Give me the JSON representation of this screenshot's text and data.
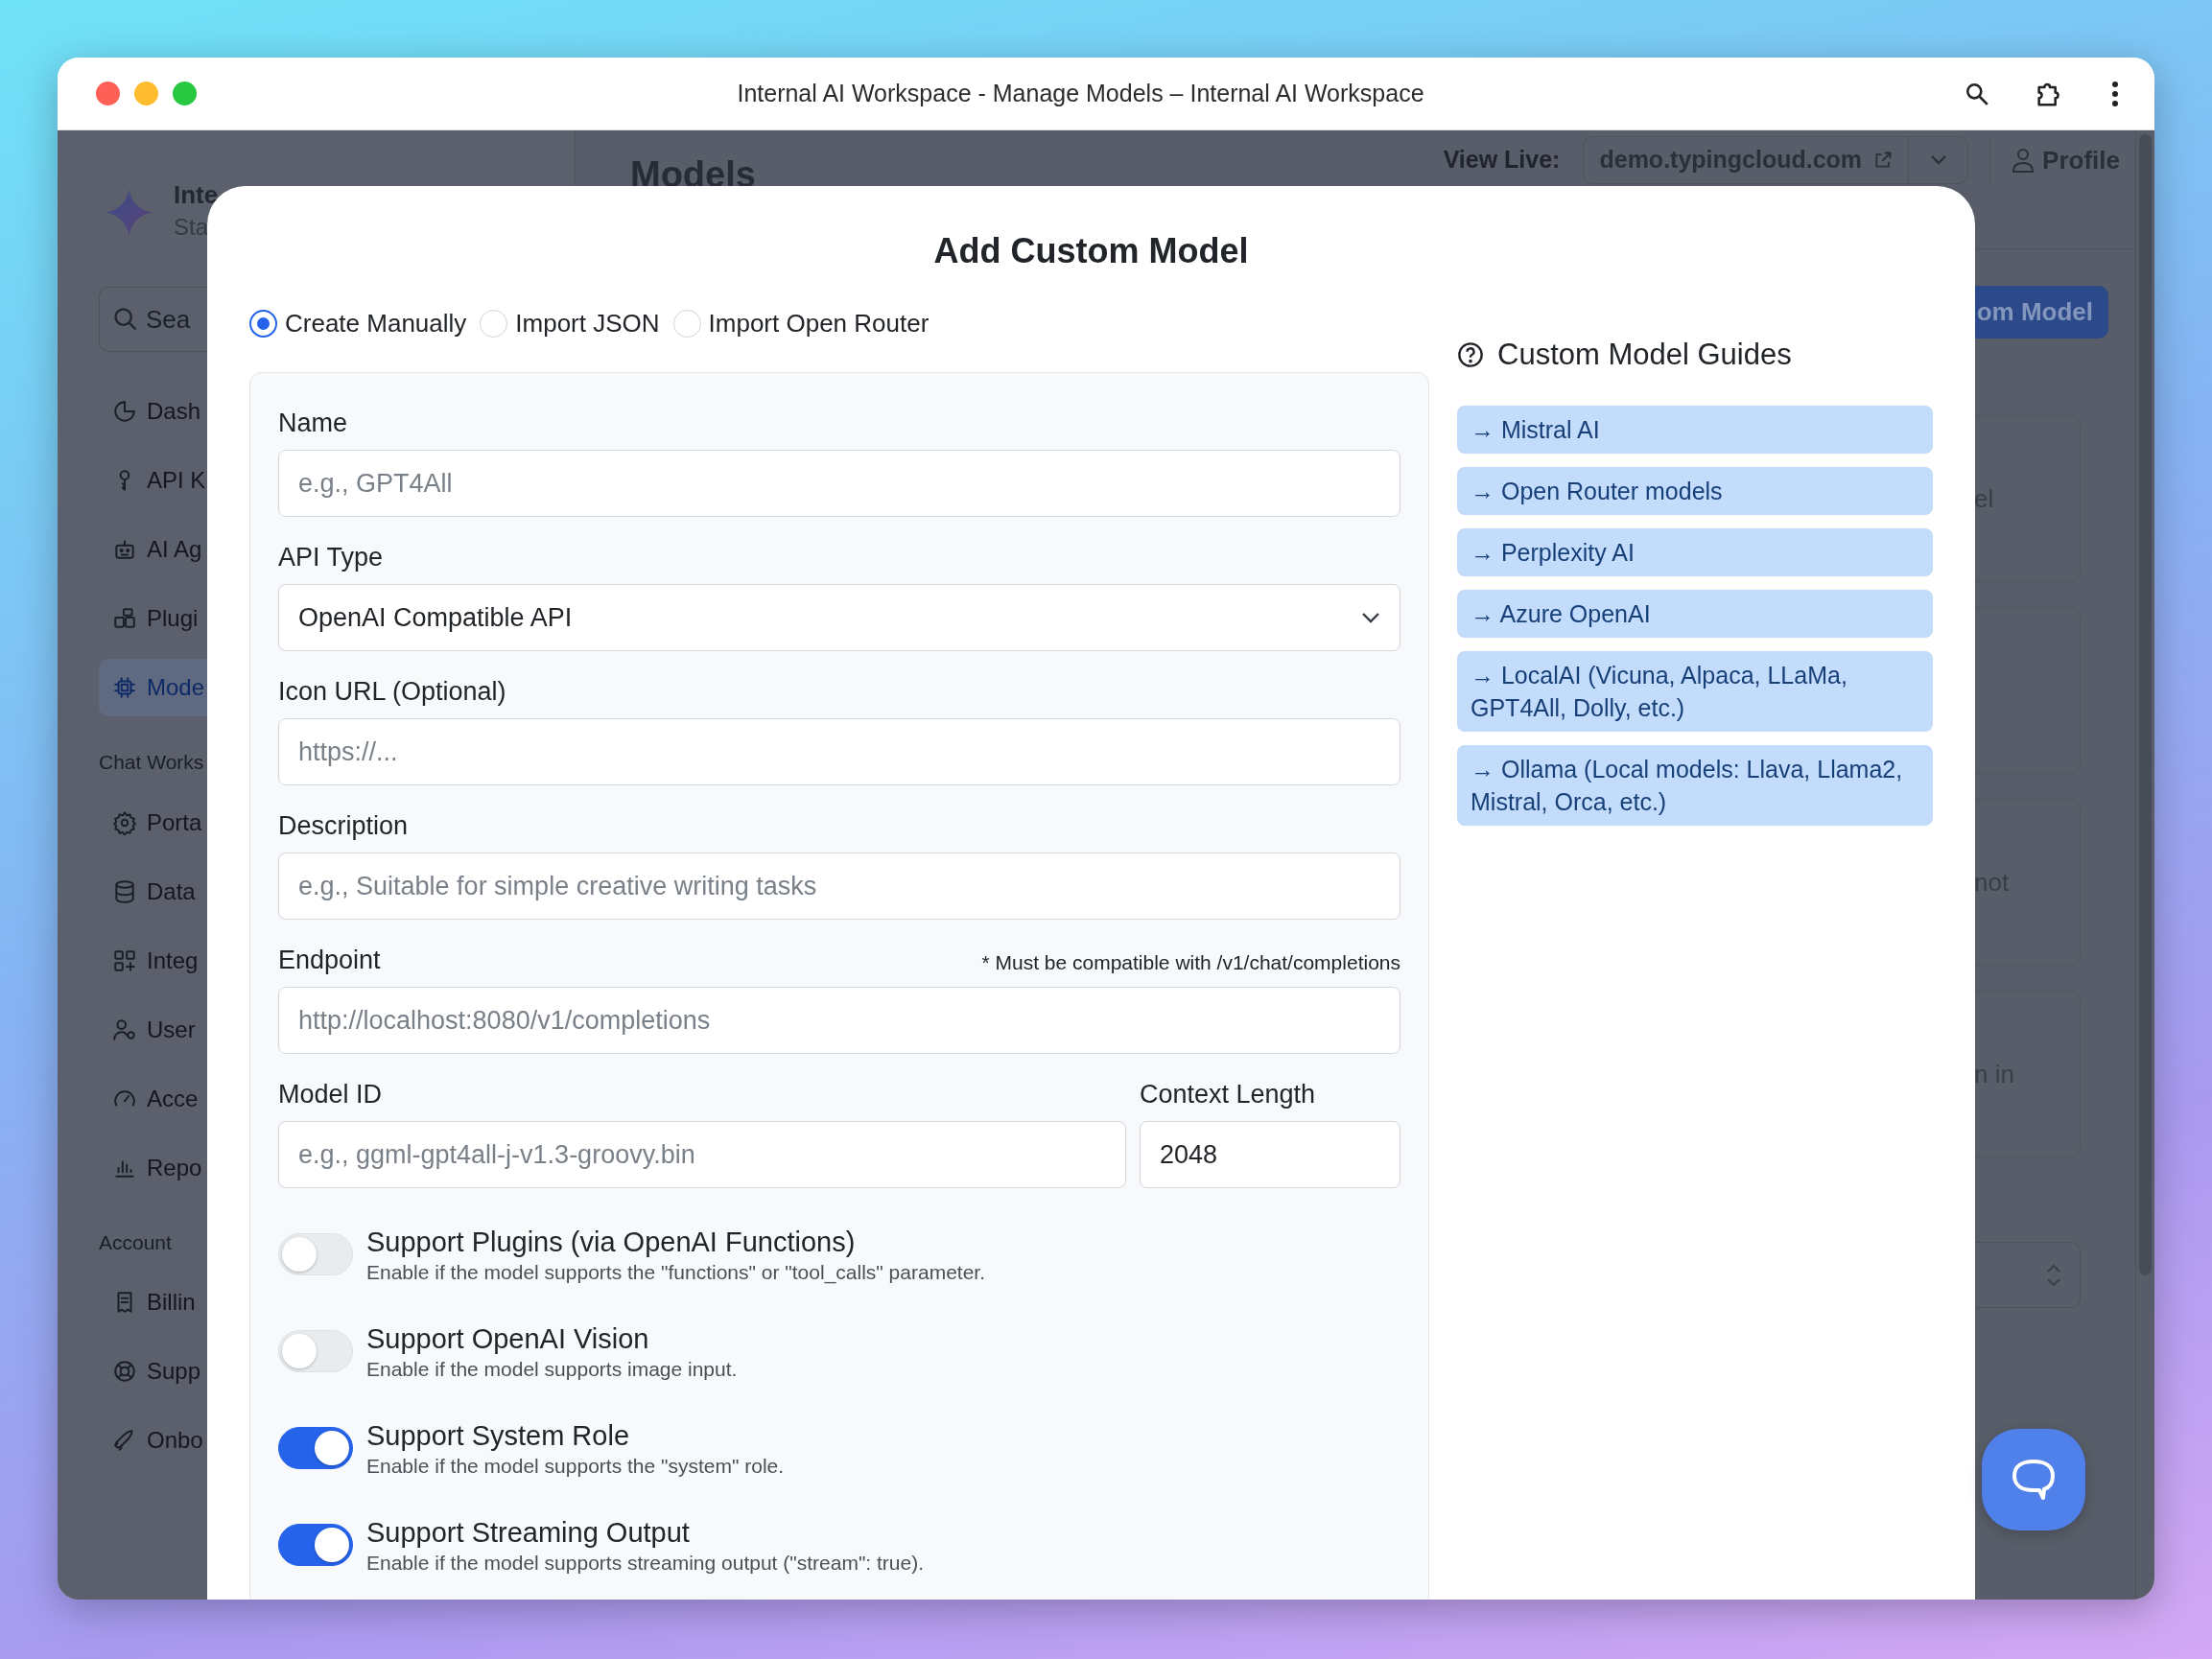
{
  "window": {
    "title": "Internal AI Workspace - Manage Models – Internal AI Workspace"
  },
  "sidebar": {
    "brand": "Inte",
    "subtitle": "Sta",
    "search": {
      "placeholder": "Sea"
    },
    "sections": [
      {
        "items": [
          {
            "label": "Dash",
            "selected": false
          },
          {
            "label": "API K",
            "selected": false
          },
          {
            "label": "AI Ag",
            "selected": false
          },
          {
            "label": "Plugi",
            "selected": false
          },
          {
            "label": "Mode",
            "selected": true
          }
        ]
      },
      {
        "heading": "Chat Works",
        "items": [
          {
            "label": "Porta",
            "selected": false
          },
          {
            "label": "Data",
            "selected": false
          },
          {
            "label": "Integ",
            "selected": false
          },
          {
            "label": "User",
            "selected": false
          },
          {
            "label": "Acce",
            "selected": false
          },
          {
            "label": "Repo",
            "selected": false
          }
        ]
      },
      {
        "heading": "Account",
        "items": [
          {
            "label": "Billin",
            "selected": false
          },
          {
            "label": "Supp",
            "selected": false
          },
          {
            "label": "Onbo",
            "selected": false
          }
        ]
      }
    ]
  },
  "header": {
    "title": "Models",
    "view_live_label": "View Live:",
    "site": "demo.typingcloud.com",
    "profile": "Profile"
  },
  "primary_button": "om Model",
  "cards": [
    {
      "kind": "text",
      "text": "el"
    },
    {
      "kind": "blank"
    },
    {
      "kind": "text",
      "text": "not"
    },
    {
      "kind": "text",
      "text": "n in"
    }
  ],
  "modal": {
    "title": "Add Custom Model",
    "modes": [
      {
        "label": "Create Manually",
        "selected": true
      },
      {
        "label": "Import JSON",
        "selected": false
      },
      {
        "label": "Import Open Router",
        "selected": false
      }
    ],
    "rows": [
      {
        "fields": [
          {
            "label": "Name",
            "kind": "text",
            "placeholder": "e.g., GPT4All"
          }
        ]
      },
      {
        "fields": [
          {
            "label": "API Type",
            "kind": "select",
            "value": "OpenAI Compatible API"
          }
        ]
      },
      {
        "fields": [
          {
            "label": "Icon URL (Optional)",
            "kind": "text",
            "placeholder": "https://..."
          }
        ]
      },
      {
        "fields": [
          {
            "label": "Description",
            "kind": "text",
            "placeholder": "e.g., Suitable for simple creative writing tasks"
          }
        ]
      },
      {
        "fields": [
          {
            "label": "Endpoint",
            "kind": "text",
            "hint": "* Must be compatible with /v1/chat/completions",
            "placeholder": "http://localhost:8080/v1/completions"
          }
        ]
      },
      {
        "fields": [
          {
            "label": "Model ID",
            "kind": "text",
            "placeholder": "e.g., ggml-gpt4all-j-v1.3-groovy.bin"
          },
          {
            "label": "Context Length",
            "kind": "text",
            "value": "2048"
          }
        ]
      }
    ],
    "toggles": [
      {
        "title": "Support Plugins (via OpenAI Functions)",
        "description": "Enable if the model supports the \"functions\" or \"tool_calls\" parameter.",
        "on": false
      },
      {
        "title": "Support OpenAI Vision",
        "description": "Enable if the model supports image input.",
        "on": false
      },
      {
        "title": "Support System Role",
        "description": "Enable if the model supports the \"system\" role.",
        "on": true
      },
      {
        "title": "Support Streaming Output",
        "description": "Enable if the model supports streaming output (\"stream\": true).",
        "on": true
      }
    ],
    "guides": {
      "title": "Custom Model Guides",
      "links": [
        "→ Mistral AI",
        "→ Open Router models",
        "→ Perplexity AI",
        "→ Azure OpenAI",
        "→ LocalAI (Vicuna, Alpaca, LLaMa, GPT4All, Dolly, etc.)",
        "→ Ollama (Local models: Llava, Llama2, Mistral, Orca, etc.)"
      ]
    }
  }
}
